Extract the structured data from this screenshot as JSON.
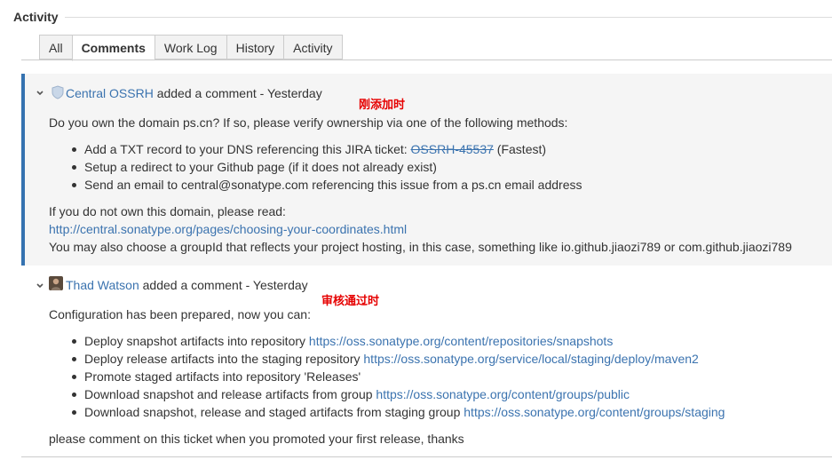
{
  "section": {
    "title": "Activity"
  },
  "tabs": [
    {
      "label": "All",
      "active": false
    },
    {
      "label": "Comments",
      "active": true
    },
    {
      "label": "Work Log",
      "active": false
    },
    {
      "label": "History",
      "active": false
    },
    {
      "label": "Activity",
      "active": false
    }
  ],
  "comments": [
    {
      "author": "Central OSSRH",
      "action": "added a comment - Yesterday",
      "annotation": "刚添加时",
      "intro": "Do you own the domain ps.cn? If so, please verify ownership via one of the following methods:",
      "items": {
        "txt_prefix": "Add a TXT record to your DNS referencing this JIRA ticket: ",
        "txt_ticket": "OSSRH-45537",
        "txt_suffix": " (Fastest)",
        "redirect": "Setup a redirect to your Github page (if it does not already exist)",
        "email": "Send an email to central@sonatype.com referencing this issue from a ps.cn email address"
      },
      "not_own": "If you do not own this domain, please read:",
      "link": "http://central.sonatype.org/pages/choosing-your-coordinates.html",
      "also": "You may also choose a groupId that reflects your project hosting, in this case, something like io.github.jiaozi789 or com.github.jiaozi789"
    },
    {
      "author": "Thad Watson",
      "action": "added a comment - Yesterday",
      "annotation": "审核通过时",
      "intro": "Configuration has been prepared, now you can:",
      "items": [
        {
          "text": "Deploy snapshot artifacts into repository ",
          "link": "https://oss.sonatype.org/content/repositories/snapshots"
        },
        {
          "text": "Deploy release artifacts into the staging repository ",
          "link": "https://oss.sonatype.org/service/local/staging/deploy/maven2"
        },
        {
          "text": "Promote staged artifacts into repository 'Releases'",
          "link": ""
        },
        {
          "text": "Download snapshot and release artifacts from group ",
          "link": "https://oss.sonatype.org/content/groups/public"
        },
        {
          "text": "Download snapshot, release and staged artifacts from staging group ",
          "link": "https://oss.sonatype.org/content/groups/staging"
        }
      ],
      "closing": "please comment on this ticket when you promoted your first release, thanks"
    }
  ],
  "icons": {
    "chevron": "chevron-down-icon",
    "avatar1": "shield-avatar-icon",
    "avatar2": "user-avatar-icon"
  },
  "colors": {
    "link": "#3b73af",
    "focus_border": "#3572b0",
    "annotation": "#e60000",
    "focused_bg": "#f5f5f5"
  }
}
